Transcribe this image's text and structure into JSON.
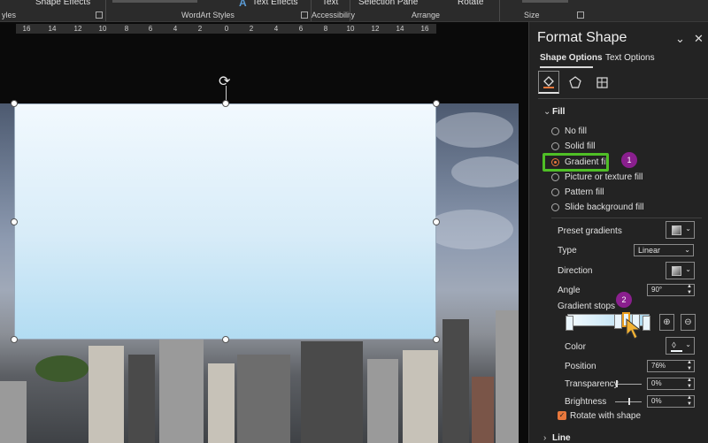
{
  "ribbon": {
    "shape_effects": "Shape Effects",
    "styles_group": "yles",
    "wordart_styles": "WordArt Styles",
    "text_effects": "Text Effects",
    "text_top": "Text",
    "accessibility": "Accessibility",
    "selection_pane": "Selection Pane",
    "rotate": "Rotate",
    "arrange": "Arrange",
    "size": "Size"
  },
  "ruler": {
    "labels": [
      "16",
      "14",
      "12",
      "10",
      "8",
      "6",
      "4",
      "2",
      "0",
      "2",
      "4",
      "6",
      "8",
      "10",
      "12",
      "14",
      "16"
    ]
  },
  "panel": {
    "title": "Format Shape",
    "tabs": [
      "Shape Options",
      "Text Options"
    ],
    "section_fill": "Fill",
    "fill_options": [
      "No fill",
      "Solid fill",
      "Gradient fill",
      "Picture or texture fill",
      "Pattern fill",
      "Slide background fill"
    ],
    "selected_fill": "Gradient fill",
    "preset_gradients": "Preset gradients",
    "type_label": "Type",
    "type_value": "Linear",
    "direction_label": "Direction",
    "angle_label": "Angle",
    "angle_value": "90°",
    "gradient_stops": "Gradient stops",
    "color_label": "Color",
    "position_label": "Position",
    "position_value": "76%",
    "transparency_label": "Transparency",
    "transparency_value": "0%",
    "brightness_label": "Brightness",
    "brightness_value": "0%",
    "rotate_with_shape": "Rotate with shape",
    "section_line": "Line",
    "badge1": "1",
    "badge2": "2"
  },
  "colors": {
    "accent": "#e8783c",
    "highlight_box": "#4fbf26",
    "badge": "#8a1f8e"
  }
}
